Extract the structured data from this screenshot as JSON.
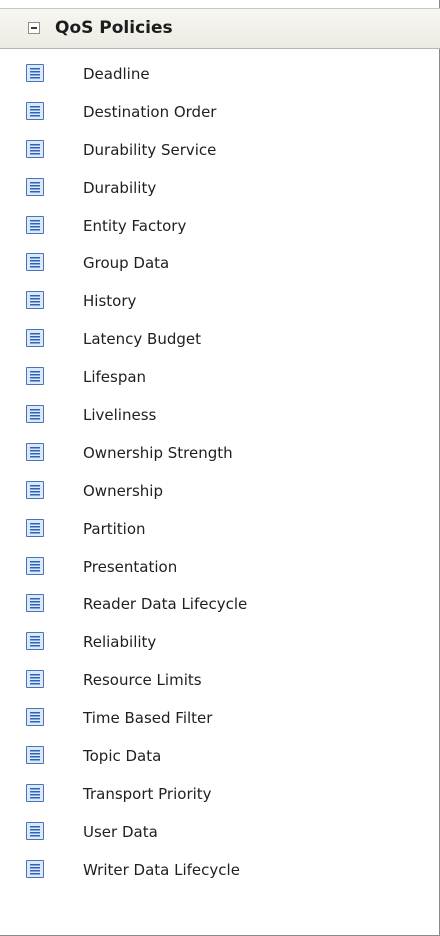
{
  "panel": {
    "title": "QoS Policies",
    "items": [
      {
        "label": "Deadline"
      },
      {
        "label": "Destination Order"
      },
      {
        "label": "Durability Service"
      },
      {
        "label": "Durability"
      },
      {
        "label": "Entity Factory"
      },
      {
        "label": "Group Data"
      },
      {
        "label": "History"
      },
      {
        "label": "Latency Budget"
      },
      {
        "label": "Lifespan"
      },
      {
        "label": "Liveliness"
      },
      {
        "label": "Ownership Strength"
      },
      {
        "label": "Ownership"
      },
      {
        "label": "Partition"
      },
      {
        "label": "Presentation"
      },
      {
        "label": "Reader Data Lifecycle"
      },
      {
        "label": "Reliability"
      },
      {
        "label": "Resource Limits"
      },
      {
        "label": "Time Based Filter"
      },
      {
        "label": "Topic Data"
      },
      {
        "label": "Transport Priority"
      },
      {
        "label": "User Data"
      },
      {
        "label": "Writer Data Lifecycle"
      }
    ]
  },
  "icons": {
    "header_toggle": "collapse-minus-icon",
    "item_icon": "policy-document-icon"
  },
  "colors": {
    "icon_border": "#4b74b8",
    "icon_fill": "#dce9fb",
    "icon_lines": "#2f63b5"
  }
}
